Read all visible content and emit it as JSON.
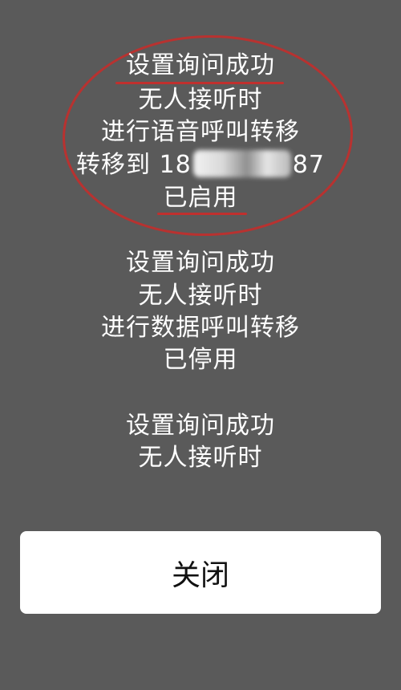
{
  "dialog": {
    "groups": [
      {
        "lines": [
          "设置询问成功",
          "无人接听时",
          "进行语音呼叫转移",
          {
            "prefix": "转移到 18",
            "suffix": "87"
          },
          "已启用"
        ]
      },
      {
        "lines": [
          "设置询问成功",
          "无人接听时",
          "进行数据呼叫转移",
          "已停用"
        ]
      },
      {
        "lines": [
          "设置询问成功",
          "无人接听时"
        ]
      }
    ],
    "close_label": "关闭"
  },
  "annotation": {
    "color": "#b83230"
  },
  "colors": {
    "background": "#5a5a5a",
    "text": "#ffffff",
    "button_bg": "#ffffff",
    "button_text": "#111111"
  }
}
